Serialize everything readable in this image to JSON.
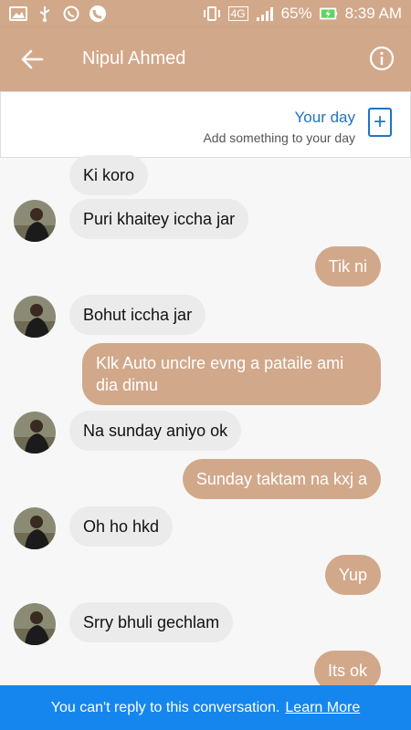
{
  "status_bar": {
    "battery": "65%",
    "time": "8:39 AM",
    "network": "4G"
  },
  "header": {
    "title": "Nipul Ahmed",
    "back_icon": "arrow-left-icon",
    "info_icon": "info-icon"
  },
  "your_day": {
    "title": "Your day",
    "subtitle": "Add something to your day",
    "add_icon": "plus-icon"
  },
  "messages": [
    {
      "dir": "in",
      "text": "Ki koro"
    },
    {
      "dir": "in",
      "text": "Puri khaitey iccha jar"
    },
    {
      "dir": "out",
      "text": "Tik ni"
    },
    {
      "dir": "in",
      "text": "Bohut iccha jar"
    },
    {
      "dir": "out",
      "text": "Klk Auto unclre evng a pataile ami dia dimu"
    },
    {
      "dir": "in",
      "text": "Na sunday aniyo ok"
    },
    {
      "dir": "out",
      "text": "Sunday taktam na kxj a"
    },
    {
      "dir": "in",
      "text": "Oh ho hkd"
    },
    {
      "dir": "out",
      "text": "Yup"
    },
    {
      "dir": "in",
      "text": "Srry bhuli gechlam"
    },
    {
      "dir": "out",
      "text": "Its ok"
    }
  ],
  "footer": {
    "text": "You can't reply to this conversation.",
    "link": "Learn More"
  },
  "colors": {
    "accent": "#d2a88a",
    "blue": "#1586ee",
    "incoming": "#ebebeb"
  }
}
